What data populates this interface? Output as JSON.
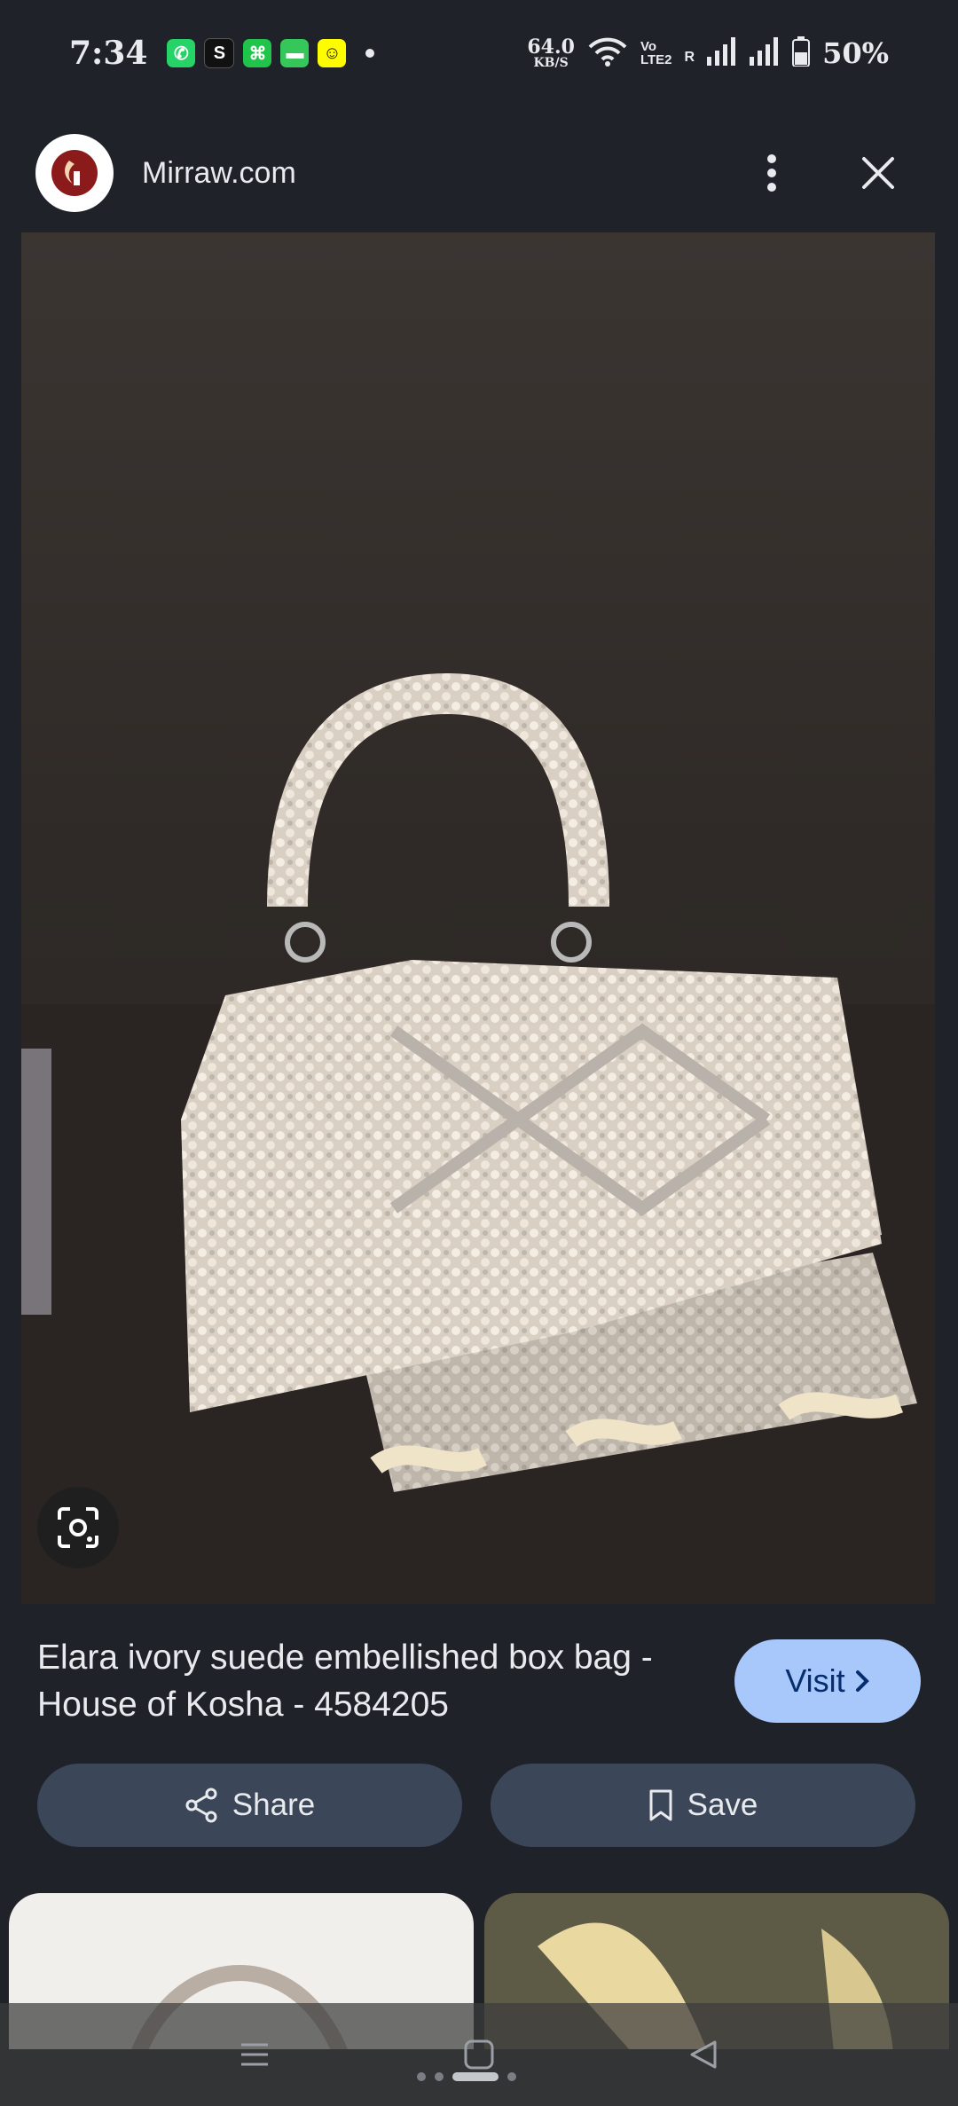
{
  "status_bar": {
    "time": "7:34",
    "notif_icons": [
      {
        "name": "whatsapp-icon",
        "color": "#25d366",
        "glyph": "✆"
      },
      {
        "name": "s-app-icon",
        "color": "#111111",
        "glyph": "S"
      },
      {
        "name": "green-app-icon",
        "color": "#21c44a",
        "glyph": "⌘"
      },
      {
        "name": "messages-icon",
        "color": "#35c759",
        "glyph": "▬"
      },
      {
        "name": "snapchat-icon",
        "color": "#fffc00",
        "glyph": "☺"
      }
    ],
    "net_speed_value": "64.0",
    "net_speed_unit": "KB/S",
    "volte_top": "Vo",
    "volte_bottom": "LTE2",
    "roaming": "R",
    "battery": "50%"
  },
  "header": {
    "site_name": "Mirraw.com"
  },
  "hero": {
    "description": "product-image"
  },
  "product": {
    "title": "Elara ivory suede embellished box bag - House of Kosha - 4584205",
    "visit_label": "Visit"
  },
  "actions": {
    "share_label": "Share",
    "save_label": "Save"
  },
  "colors": {
    "background": "#1f2229",
    "visit_button": "#a8c7fa",
    "pill_button": "#3b4658"
  }
}
